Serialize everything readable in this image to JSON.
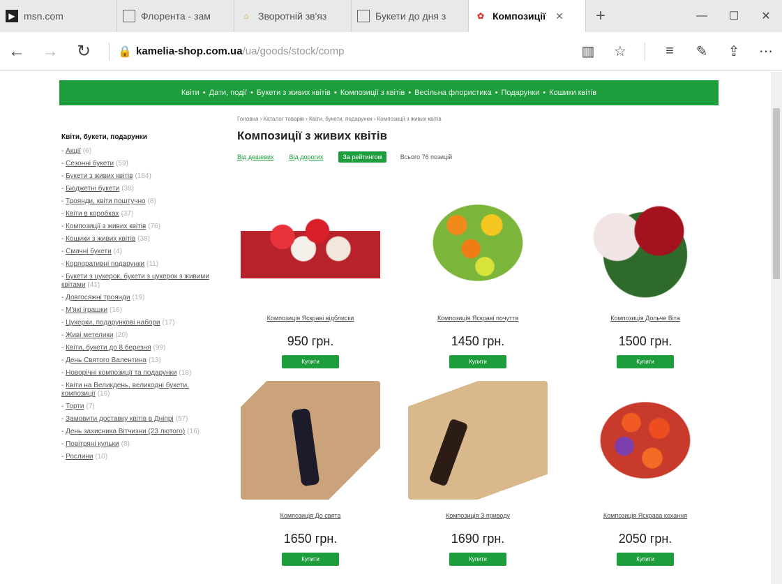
{
  "browser": {
    "tabs": [
      {
        "label": "msn.com",
        "icon": "msn-icon",
        "active": false
      },
      {
        "label": "Флорента - зам",
        "icon": "page-icon",
        "active": false
      },
      {
        "label": "Зворотній зв'яз",
        "icon": "home-icon",
        "active": false
      },
      {
        "label": "Букети до дня з",
        "icon": "page-icon",
        "active": false
      },
      {
        "label": "Композиції",
        "icon": "flower-icon",
        "active": true
      }
    ],
    "new_tab": "+",
    "controls": {
      "minimize": "—",
      "maximize": "☐",
      "close": "✕"
    },
    "nav": {
      "back": "←",
      "forward": "→",
      "refresh": "↻"
    },
    "url": {
      "lock": "🔒",
      "domain": "kamelia-shop.com.ua",
      "path": "/ua/goods/stock/comp"
    },
    "tools": {
      "reading": "▥",
      "favorite": "☆",
      "hub": "≡",
      "notes": "✎",
      "share": "⇪",
      "more": "⋯"
    }
  },
  "site": {
    "nav": [
      "Квіти",
      "Дати, події",
      "Букети з живих квітів",
      "Композиції з квітів",
      "Весільна флористика",
      "Подарунки",
      "Кошики квітів"
    ],
    "nav_separator": "•",
    "sidebar": {
      "title": "Квіти, букети, подарунки",
      "items": [
        {
          "label": "Акції",
          "count": "(6)"
        },
        {
          "label": "Сезонні букети",
          "count": "(59)"
        },
        {
          "label": "Букети з живих квітів",
          "count": "(184)"
        },
        {
          "label": "Бюджетні букети",
          "count": "(38)"
        },
        {
          "label": "Троянди, квіти поштучно",
          "count": "(8)"
        },
        {
          "label": "Квіти в коробках",
          "count": "(37)"
        },
        {
          "label": "Композиції з живих квітів",
          "count": "(76)"
        },
        {
          "label": "Кошики з живих квітів",
          "count": "(38)"
        },
        {
          "label": "Смачні букети",
          "count": "(4)"
        },
        {
          "label": "Корпоративні подарунки",
          "count": "(11)"
        },
        {
          "label": "Букети з цукерок, букети з цукерок з живими квітами",
          "count": "(41)"
        },
        {
          "label": "Довгосяжні троянди",
          "count": "(19)"
        },
        {
          "label": "М'які іграшки",
          "count": "(16)"
        },
        {
          "label": "Цукерки, подарункові набори",
          "count": "(17)"
        },
        {
          "label": "Живі метелики",
          "count": "(20)"
        },
        {
          "label": "Квіти, букети до 8 березня",
          "count": "(99)"
        },
        {
          "label": "День Святого Валентина",
          "count": "(13)"
        },
        {
          "label": "Новорічні композиції та подарунки",
          "count": "(18)"
        },
        {
          "label": "Квіти на Великдень, великодні букети, композиції",
          "count": "(16)"
        },
        {
          "label": "Торти",
          "count": "(7)"
        },
        {
          "label": "Замовити доставку квітів в Дніпрі",
          "count": "(57)"
        },
        {
          "label": "День захисника Вітчизни (23 лютого)",
          "count": "(16)"
        },
        {
          "label": "Повітряні кульки",
          "count": "(8)"
        },
        {
          "label": "Рослини",
          "count": "(10)"
        }
      ]
    },
    "breadcrumb": "Головна › Каталог товарів › Квіти, букети, подарунки › Композиції з живих квітів",
    "title": "Композиції з живих квітів",
    "sort": {
      "cheap": "Від дешевих",
      "expensive": "Від дорогих",
      "rating": "За рейтингом",
      "total": "Всього 76 позицій"
    },
    "buy_label": "Купити",
    "products": [
      {
        "name": "Композиція Яскраві відблиски",
        "price": "950 грн."
      },
      {
        "name": "Композиція Яскраві почуття",
        "price": "1450 грн."
      },
      {
        "name": "Композиція Дольче Віта",
        "price": "1500 грн."
      },
      {
        "name": "Композиція До свята",
        "price": "1650 грн."
      },
      {
        "name": "Композиція З приводу",
        "price": "1690 грн."
      },
      {
        "name": "Композиція Яскрава кохання",
        "price": "2050 грн."
      }
    ]
  }
}
